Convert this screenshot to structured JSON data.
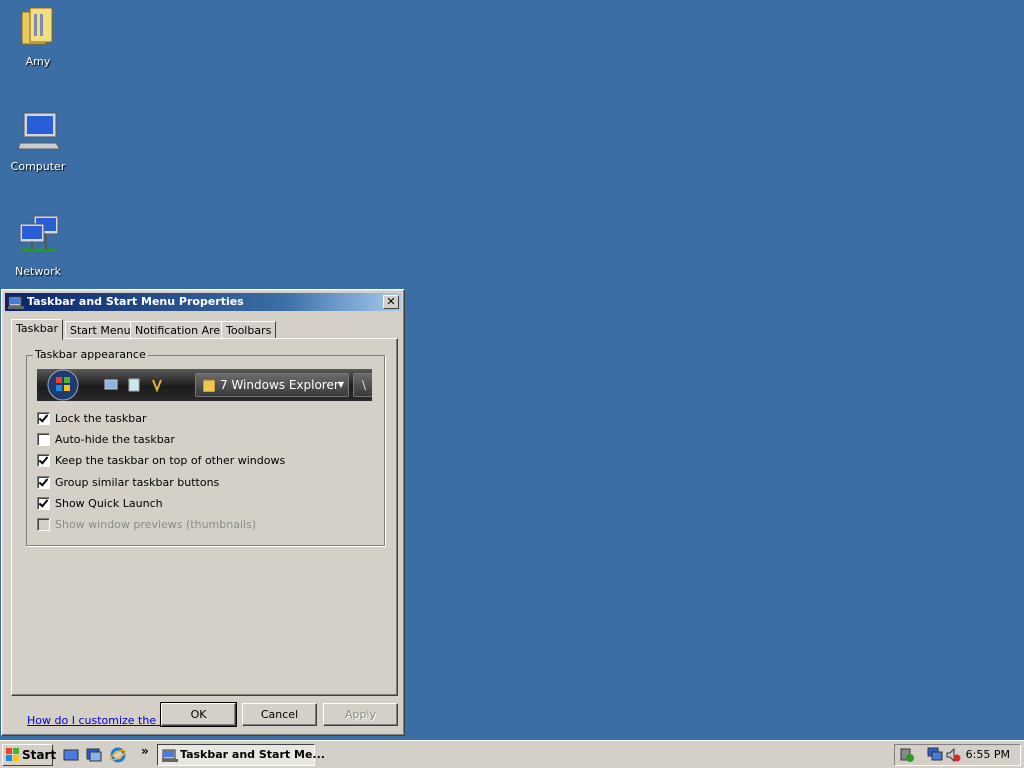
{
  "desktop": {
    "icons": [
      {
        "label": "Amy",
        "icon": "user-folder-icon"
      },
      {
        "label": "Computer",
        "icon": "computer-icon"
      },
      {
        "label": "Network",
        "icon": "network-icon"
      }
    ]
  },
  "dialog": {
    "title": "Taskbar and Start Menu Properties",
    "close_symbol": "✕",
    "tabs": [
      {
        "label": "Taskbar",
        "active": true
      },
      {
        "label": "Start Menu",
        "active": false
      },
      {
        "label": "Notification Area",
        "active": false
      },
      {
        "label": "Toolbars",
        "active": false
      }
    ],
    "group_title": "Taskbar appearance",
    "preview": {
      "task_button_label": "7 Windows Explorer",
      "task_button_partial": "\\"
    },
    "options": [
      {
        "label": "Lock the taskbar",
        "checked": true,
        "enabled": true
      },
      {
        "label": "Auto-hide the taskbar",
        "checked": false,
        "enabled": true
      },
      {
        "label": "Keep the taskbar on top of other windows",
        "checked": true,
        "enabled": true
      },
      {
        "label": "Group similar taskbar buttons",
        "checked": true,
        "enabled": true
      },
      {
        "label": "Show Quick Launch",
        "checked": true,
        "enabled": true
      },
      {
        "label": "Show window previews (thumbnails)",
        "checked": false,
        "enabled": false
      }
    ],
    "help_link": "How do I customize the taskbar?",
    "buttons": {
      "ok": "OK",
      "cancel": "Cancel",
      "apply": "Apply"
    }
  },
  "taskbar": {
    "start_label": "Start",
    "chevron": "»",
    "active_task_label": "Taskbar and Start Me...",
    "clock": "6:55 PM"
  },
  "colors": {
    "desktop_bg": "#3a6ea5",
    "titlebar_start": "#0a246a",
    "face": "#d4d0c8",
    "link": "#0000cc"
  }
}
